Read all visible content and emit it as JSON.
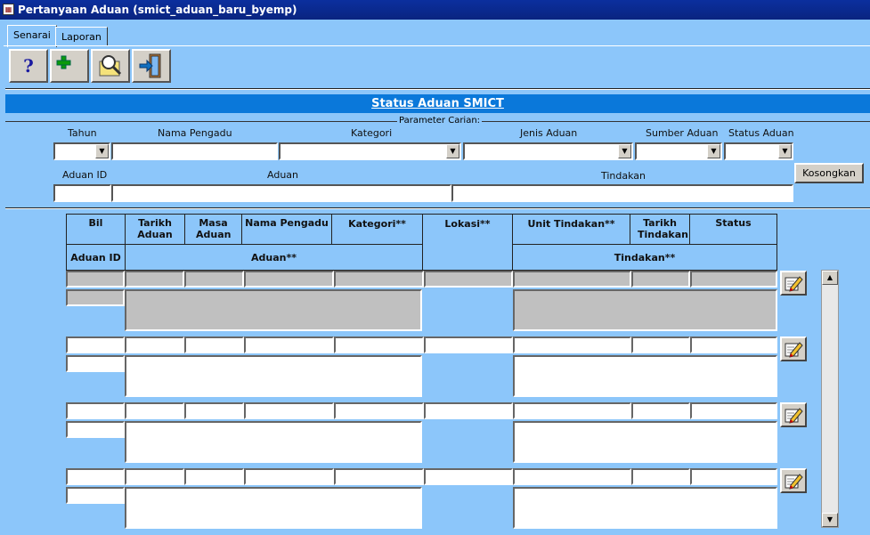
{
  "window": {
    "title": "Pertanyaan Aduan (smict_aduan_baru_byemp)"
  },
  "tabs": [
    {
      "label": "Senarai"
    },
    {
      "label": "Laporan"
    }
  ],
  "toolbar": [
    {
      "icon": "help-icon"
    },
    {
      "icon": "add-icon"
    },
    {
      "icon": "search-icon"
    },
    {
      "icon": "exit-icon"
    }
  ],
  "banner": {
    "title": "Status Aduan SMICT"
  },
  "params": {
    "legend": "Parameter Carian:",
    "tahun": "Tahun",
    "nama_pengadu": "Nama Pengadu",
    "kategori": "Kategori",
    "jenis_aduan": "Jenis Aduan",
    "sumber_aduan": "Sumber Aduan",
    "status_aduan": "Status Aduan",
    "aduan_id": "Aduan ID",
    "aduan": "Aduan",
    "tindakan": "Tindakan",
    "clear_button": "Kosongkan"
  },
  "table": {
    "headers": {
      "bil": "Bil",
      "tarikh_aduan": "Tarikh Aduan",
      "masa_aduan": "Masa Aduan",
      "nama_pengadu": "Nama Pengadu",
      "kategori": "Kategori**",
      "lokasi": "Lokasi**",
      "unit_tindakan": "Unit Tindakan**",
      "tarikh_tindakan": "Tarikh Tindakan",
      "status": "Status",
      "aduan_id": "Aduan ID",
      "aduan": "Aduan**",
      "tindakan": "Tindakan**"
    },
    "record_count": 4
  }
}
